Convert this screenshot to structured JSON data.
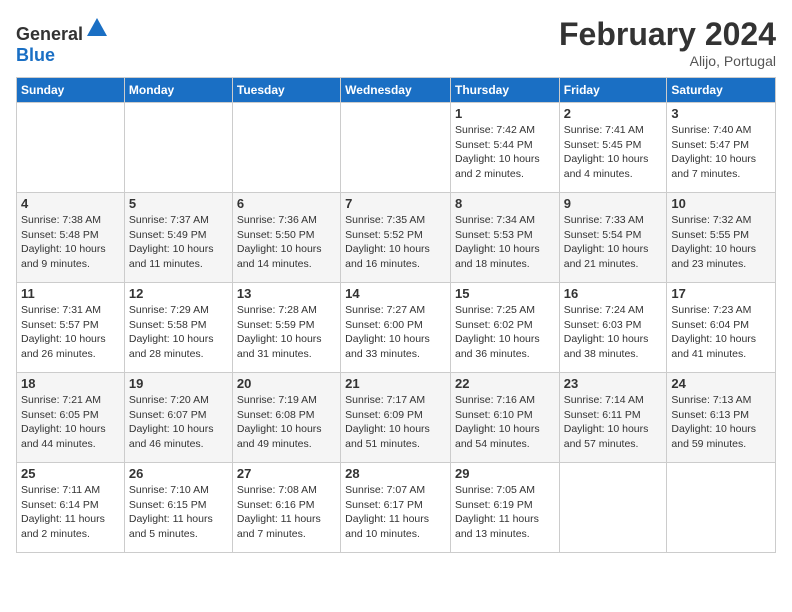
{
  "header": {
    "logo_general": "General",
    "logo_blue": "Blue",
    "month_year": "February 2024",
    "location": "Alijo, Portugal"
  },
  "weekdays": [
    "Sunday",
    "Monday",
    "Tuesday",
    "Wednesday",
    "Thursday",
    "Friday",
    "Saturday"
  ],
  "weeks": [
    [
      {
        "day": "",
        "info": ""
      },
      {
        "day": "",
        "info": ""
      },
      {
        "day": "",
        "info": ""
      },
      {
        "day": "",
        "info": ""
      },
      {
        "day": "1",
        "info": "Sunrise: 7:42 AM\nSunset: 5:44 PM\nDaylight: 10 hours\nand 2 minutes."
      },
      {
        "day": "2",
        "info": "Sunrise: 7:41 AM\nSunset: 5:45 PM\nDaylight: 10 hours\nand 4 minutes."
      },
      {
        "day": "3",
        "info": "Sunrise: 7:40 AM\nSunset: 5:47 PM\nDaylight: 10 hours\nand 7 minutes."
      }
    ],
    [
      {
        "day": "4",
        "info": "Sunrise: 7:38 AM\nSunset: 5:48 PM\nDaylight: 10 hours\nand 9 minutes."
      },
      {
        "day": "5",
        "info": "Sunrise: 7:37 AM\nSunset: 5:49 PM\nDaylight: 10 hours\nand 11 minutes."
      },
      {
        "day": "6",
        "info": "Sunrise: 7:36 AM\nSunset: 5:50 PM\nDaylight: 10 hours\nand 14 minutes."
      },
      {
        "day": "7",
        "info": "Sunrise: 7:35 AM\nSunset: 5:52 PM\nDaylight: 10 hours\nand 16 minutes."
      },
      {
        "day": "8",
        "info": "Sunrise: 7:34 AM\nSunset: 5:53 PM\nDaylight: 10 hours\nand 18 minutes."
      },
      {
        "day": "9",
        "info": "Sunrise: 7:33 AM\nSunset: 5:54 PM\nDaylight: 10 hours\nand 21 minutes."
      },
      {
        "day": "10",
        "info": "Sunrise: 7:32 AM\nSunset: 5:55 PM\nDaylight: 10 hours\nand 23 minutes."
      }
    ],
    [
      {
        "day": "11",
        "info": "Sunrise: 7:31 AM\nSunset: 5:57 PM\nDaylight: 10 hours\nand 26 minutes."
      },
      {
        "day": "12",
        "info": "Sunrise: 7:29 AM\nSunset: 5:58 PM\nDaylight: 10 hours\nand 28 minutes."
      },
      {
        "day": "13",
        "info": "Sunrise: 7:28 AM\nSunset: 5:59 PM\nDaylight: 10 hours\nand 31 minutes."
      },
      {
        "day": "14",
        "info": "Sunrise: 7:27 AM\nSunset: 6:00 PM\nDaylight: 10 hours\nand 33 minutes."
      },
      {
        "day": "15",
        "info": "Sunrise: 7:25 AM\nSunset: 6:02 PM\nDaylight: 10 hours\nand 36 minutes."
      },
      {
        "day": "16",
        "info": "Sunrise: 7:24 AM\nSunset: 6:03 PM\nDaylight: 10 hours\nand 38 minutes."
      },
      {
        "day": "17",
        "info": "Sunrise: 7:23 AM\nSunset: 6:04 PM\nDaylight: 10 hours\nand 41 minutes."
      }
    ],
    [
      {
        "day": "18",
        "info": "Sunrise: 7:21 AM\nSunset: 6:05 PM\nDaylight: 10 hours\nand 44 minutes."
      },
      {
        "day": "19",
        "info": "Sunrise: 7:20 AM\nSunset: 6:07 PM\nDaylight: 10 hours\nand 46 minutes."
      },
      {
        "day": "20",
        "info": "Sunrise: 7:19 AM\nSunset: 6:08 PM\nDaylight: 10 hours\nand 49 minutes."
      },
      {
        "day": "21",
        "info": "Sunrise: 7:17 AM\nSunset: 6:09 PM\nDaylight: 10 hours\nand 51 minutes."
      },
      {
        "day": "22",
        "info": "Sunrise: 7:16 AM\nSunset: 6:10 PM\nDaylight: 10 hours\nand 54 minutes."
      },
      {
        "day": "23",
        "info": "Sunrise: 7:14 AM\nSunset: 6:11 PM\nDaylight: 10 hours\nand 57 minutes."
      },
      {
        "day": "24",
        "info": "Sunrise: 7:13 AM\nSunset: 6:13 PM\nDaylight: 10 hours\nand 59 minutes."
      }
    ],
    [
      {
        "day": "25",
        "info": "Sunrise: 7:11 AM\nSunset: 6:14 PM\nDaylight: 11 hours\nand 2 minutes."
      },
      {
        "day": "26",
        "info": "Sunrise: 7:10 AM\nSunset: 6:15 PM\nDaylight: 11 hours\nand 5 minutes."
      },
      {
        "day": "27",
        "info": "Sunrise: 7:08 AM\nSunset: 6:16 PM\nDaylight: 11 hours\nand 7 minutes."
      },
      {
        "day": "28",
        "info": "Sunrise: 7:07 AM\nSunset: 6:17 PM\nDaylight: 11 hours\nand 10 minutes."
      },
      {
        "day": "29",
        "info": "Sunrise: 7:05 AM\nSunset: 6:19 PM\nDaylight: 11 hours\nand 13 minutes."
      },
      {
        "day": "",
        "info": ""
      },
      {
        "day": "",
        "info": ""
      }
    ]
  ]
}
